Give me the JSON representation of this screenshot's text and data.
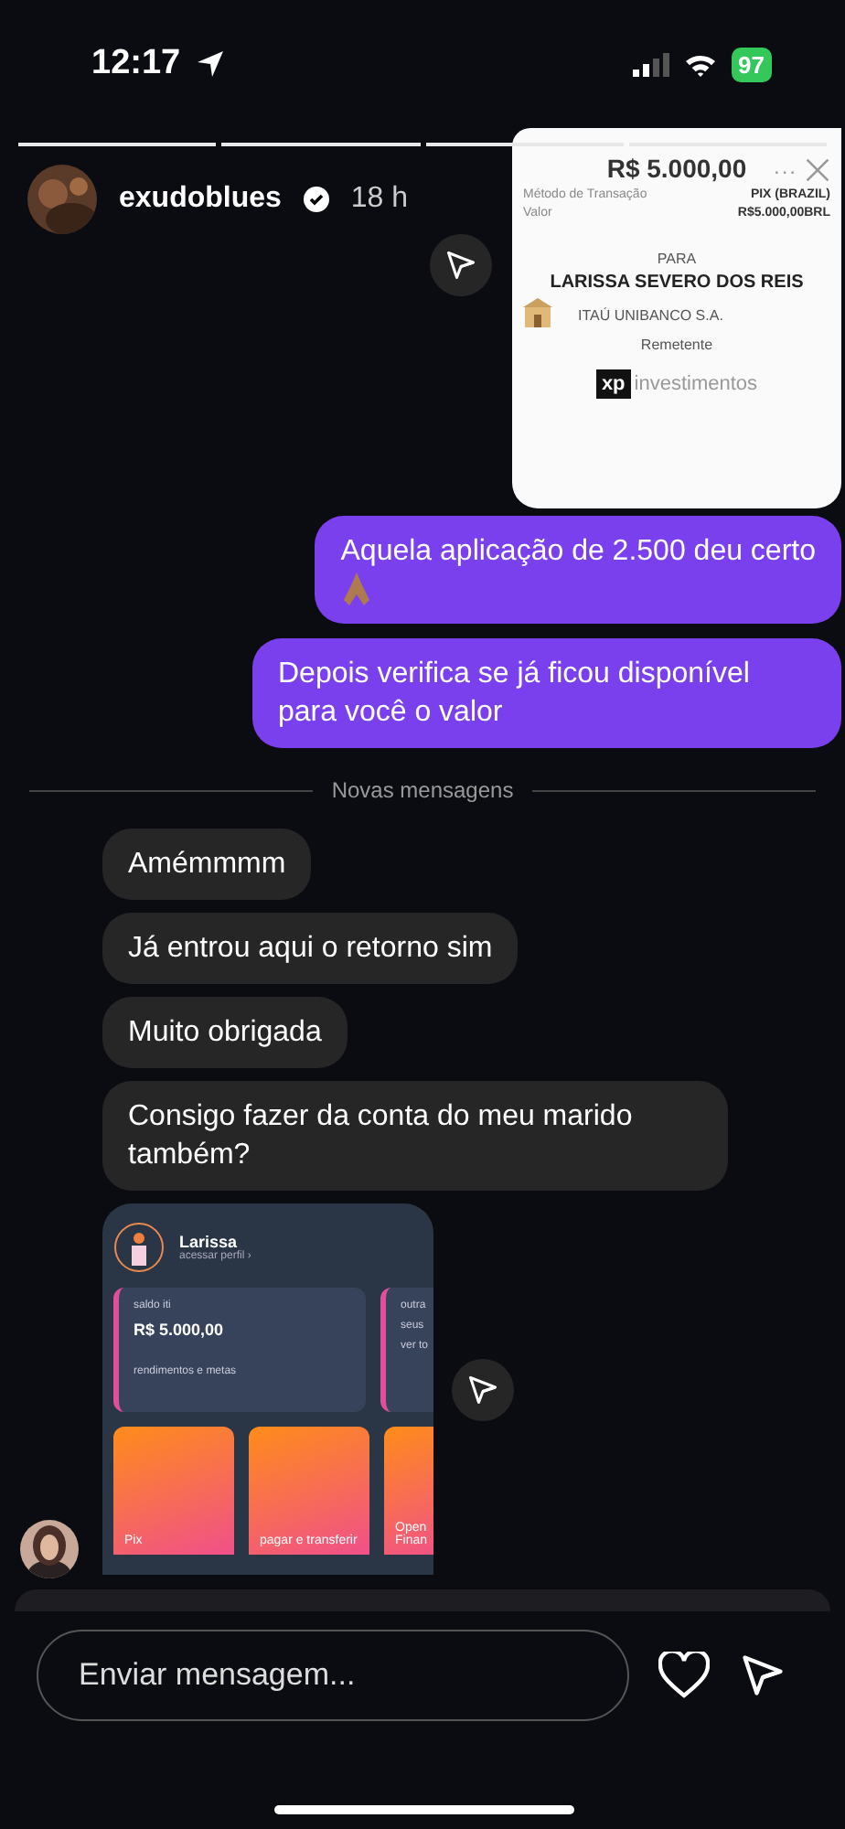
{
  "status_bar": {
    "time": "12:17",
    "battery": "97"
  },
  "story": {
    "username": "exudoblues",
    "verified": true,
    "time": "18 h",
    "segments": [
      {
        "level": 1
      },
      {
        "level": 1
      },
      {
        "level": 1
      },
      {
        "level": 1
      }
    ]
  },
  "receipt": {
    "amount": "R$ 5.000,00",
    "more": "...",
    "rows": [
      {
        "label": "Método de Transação",
        "value": "PIX (BRAZIL)"
      },
      {
        "label": "Valor",
        "value": "R$5.000,00BRL"
      }
    ],
    "to_label": "PARA",
    "recipient": "LARISSA SEVERO DOS REIS",
    "bank": "ITAÚ UNIBANCO S.A.",
    "sender_label": "Remetente",
    "sender_mark": "xp",
    "sender_name": "investimentos"
  },
  "messages": [
    {
      "kind": "sent",
      "text": "Aquela aplicação de 2.500 deu certo",
      "emoji": true
    },
    {
      "kind": "sent",
      "text": "Depois verifica se já ficou disponível para você o valor",
      "emoji": false
    }
  ],
  "divider": "Novas mensagens",
  "replies": [
    {
      "kind": "text",
      "text": "Amémmmm"
    },
    {
      "kind": "text",
      "text": "Já entrou aqui o retorno sim"
    },
    {
      "kind": "text",
      "text": "Muito obrigada"
    },
    {
      "kind": "text",
      "text": "Consigo fazer da conta do meu marido também?"
    },
    {
      "kind": "app",
      "name": "Larissa",
      "profile": "acessar perfil ›",
      "balance_label": "saldo iti",
      "balance": "R$ 5.000,00",
      "goals": "rendimentos e metas",
      "other": [
        "outra",
        "seus",
        "ver to"
      ],
      "tiles": [
        "Pix",
        "pagar e transferir",
        "Open Finan"
      ]
    }
  ],
  "composer": {
    "placeholder": "Enviar mensagem..."
  }
}
